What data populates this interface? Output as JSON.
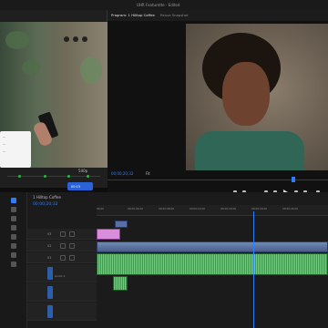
{
  "window": {
    "title": "UHR Featurette - Edited"
  },
  "popup": {
    "menu_items": [
      "...",
      "...",
      "..."
    ],
    "bottom": {
      "resolution": "540p",
      "timecode": "00:15"
    }
  },
  "program": {
    "tabs": [
      "Program: 1 Hilltop Coffee",
      "Reuse Snapshot"
    ],
    "timecode": "00;00;20;32",
    "fit": "Fit"
  },
  "timeline": {
    "sequence_label": "1 Hilltop Coffee",
    "timecode": "00;00;20;32",
    "ruler_ticks": [
      "00;00",
      "00;00;04;00",
      "00;00;08;00",
      "00;00;12;00",
      "00;00;16;00",
      "00;00;20;00",
      "00;00;24;00"
    ],
    "tracks": [
      "V3",
      "V2",
      "V1",
      "A1",
      "A2",
      "A3"
    ],
    "audio_label": "Audio 1"
  },
  "colors": {
    "accent": "#2d7dff",
    "video_clip": "#5a6fa8",
    "audio_clip": "#3f9a4d",
    "pink_clip": "#d88ed9"
  }
}
